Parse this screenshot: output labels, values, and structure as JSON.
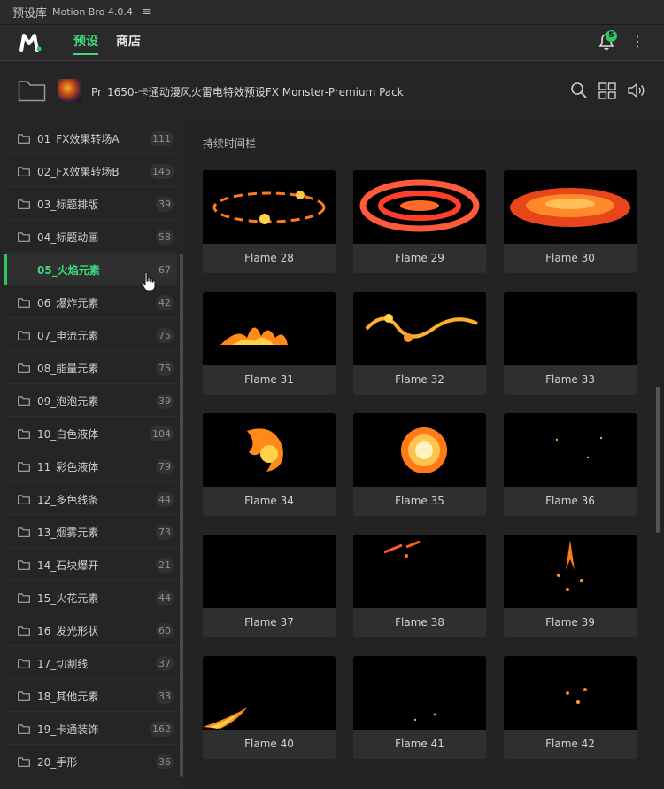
{
  "panel": {
    "title": "预设库",
    "app_name": "Motion Bro 4.0.4",
    "menu_glyph": "≡"
  },
  "header": {
    "tabs": [
      {
        "label": "预设"
      },
      {
        "label": "商店"
      }
    ],
    "notification_count": "5",
    "more_glyph": "⋮"
  },
  "pack": {
    "title": "Pr_1650-卡通动漫风火雷电特效预设FX Monster-Premium Pack"
  },
  "sidebar": {
    "items": [
      {
        "label": "01_FX效果转场A",
        "count": "111"
      },
      {
        "label": "02_FX效果转场B",
        "count": "145"
      },
      {
        "label": "03_标题排版",
        "count": "39"
      },
      {
        "label": "04_标题动画",
        "count": "58"
      },
      {
        "label": "05_火焰元素",
        "count": "67"
      },
      {
        "label": "06_爆炸元素",
        "count": "42"
      },
      {
        "label": "07_电流元素",
        "count": "75"
      },
      {
        "label": "08_能量元素",
        "count": "75"
      },
      {
        "label": "09_泡泡元素",
        "count": "39"
      },
      {
        "label": "10_白色液体",
        "count": "104"
      },
      {
        "label": "11_彩色液体",
        "count": "79"
      },
      {
        "label": "12_多色线条",
        "count": "44"
      },
      {
        "label": "13_烟雾元素",
        "count": "73"
      },
      {
        "label": "14_石块爆开",
        "count": "21"
      },
      {
        "label": "15_火花元素",
        "count": "44"
      },
      {
        "label": "16_发光形状",
        "count": "60"
      },
      {
        "label": "17_切割线",
        "count": "37"
      },
      {
        "label": "18_其他元素",
        "count": "33"
      },
      {
        "label": "19_卡通装饰",
        "count": "162"
      },
      {
        "label": "20_手形",
        "count": "36"
      }
    ],
    "active_index": 4
  },
  "main": {
    "section_title": "持续时间栏",
    "presets": [
      {
        "label": "Flame 28"
      },
      {
        "label": "Flame 29"
      },
      {
        "label": "Flame 30"
      },
      {
        "label": "Flame 31"
      },
      {
        "label": "Flame 32"
      },
      {
        "label": "Flame 33"
      },
      {
        "label": "Flame 34"
      },
      {
        "label": "Flame 35"
      },
      {
        "label": "Flame 36"
      },
      {
        "label": "Flame 37"
      },
      {
        "label": "Flame 38"
      },
      {
        "label": "Flame 39"
      },
      {
        "label": "Flame 40"
      },
      {
        "label": "Flame 41"
      },
      {
        "label": "Flame 42"
      }
    ]
  },
  "colors": {
    "accent": "#3ed97a",
    "badge": "#2ec765",
    "background": "#232323"
  }
}
